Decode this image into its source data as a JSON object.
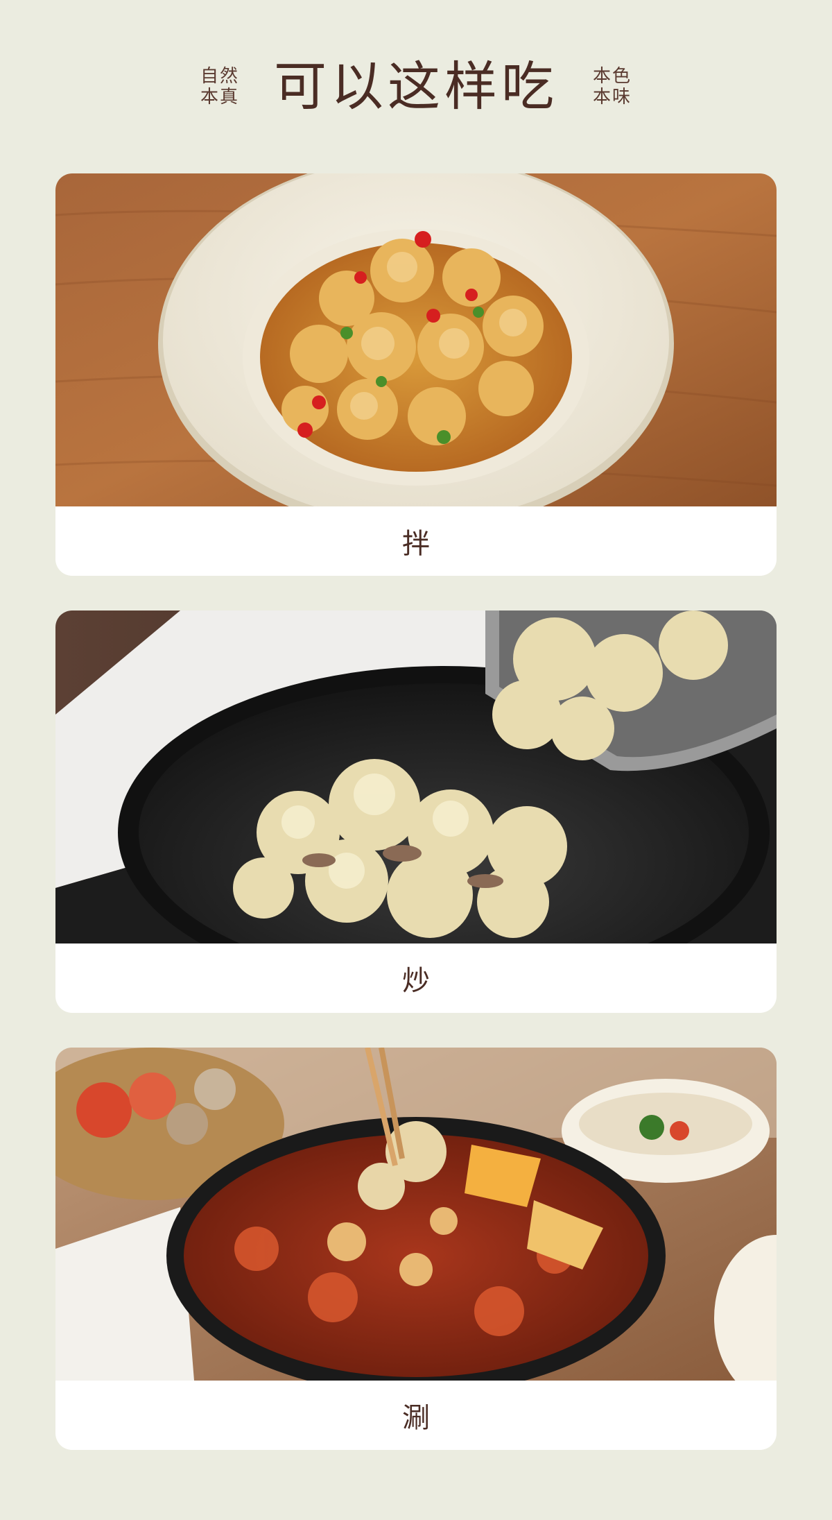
{
  "header": {
    "left_tag": [
      "自然",
      "本真"
    ],
    "title": "可以这样吃",
    "right_tag": [
      "本色",
      "本味"
    ]
  },
  "cards": [
    {
      "caption": "拌"
    },
    {
      "caption": "炒"
    },
    {
      "caption": "涮"
    }
  ],
  "colors": {
    "background": "#ebece0",
    "title": "#4a2c24",
    "card": "#ffffff"
  }
}
